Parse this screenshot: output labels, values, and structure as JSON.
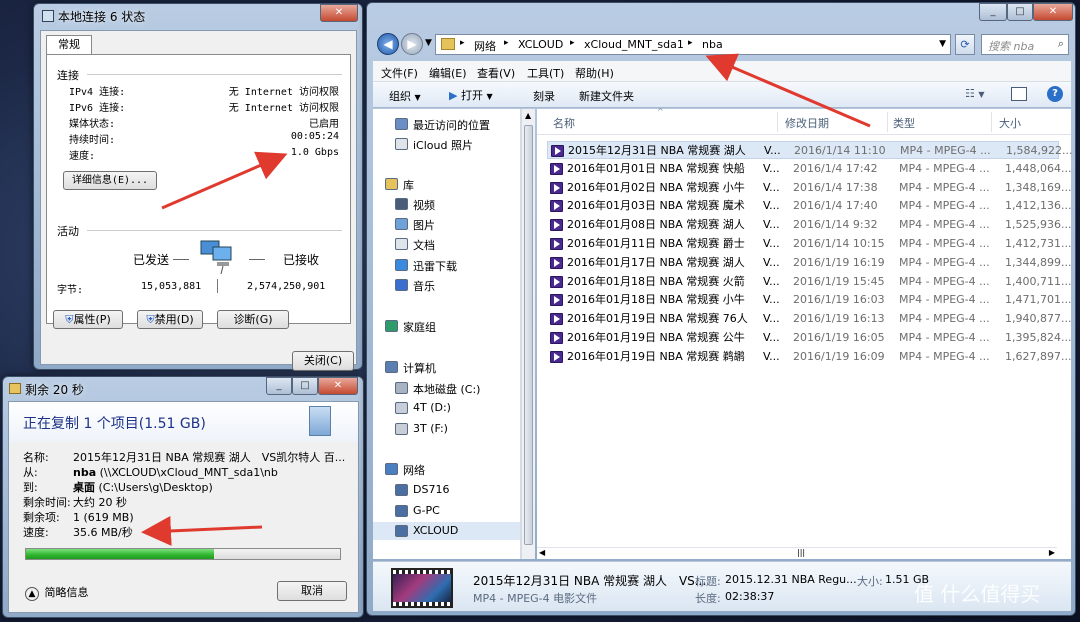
{
  "status_window": {
    "title": "本地连接 6 状态",
    "tab": "常规",
    "connection_heading": "连接",
    "rows": [
      {
        "label": "IPv4 连接:",
        "value": "无 Internet 访问权限"
      },
      {
        "label": "IPv6 连接:",
        "value": "无 Internet 访问权限"
      },
      {
        "label": "媒体状态:",
        "value": "已启用"
      },
      {
        "label": "持续时间:",
        "value": "00:05:24"
      },
      {
        "label": "速度:",
        "value": "1.0 Gbps"
      }
    ],
    "details_button": "详细信息(E)...",
    "activity_heading": "活动",
    "sent_label": "已发送",
    "received_label": "已接收",
    "bytes_label": "字节:",
    "bytes_sent": "15,053,881",
    "bytes_received": "2,574,250,901",
    "properties_button": "属性(P)",
    "disable_button": "禁用(D)",
    "diagnose_button": "诊断(G)",
    "close_button": "关闭(C)"
  },
  "copy_dialog": {
    "title": "剩余 20 秒",
    "heading": "正在复制 1 个项目(1.51 GB)",
    "rows": [
      {
        "label": "名称:",
        "value": "2015年12月31日 NBA 常规赛 湖人　VS凯尔特人 百..."
      },
      {
        "label": "从:",
        "bold": "nba",
        "value": "(\\\\XCLOUD\\xCloud_MNT_sda1\\nb"
      },
      {
        "label": "到:",
        "bold": "桌面",
        "value": "(C:\\Users\\g\\Desktop)"
      },
      {
        "label": "剩余时间:",
        "value": "大约 20 秒"
      },
      {
        "label": "剩余项:",
        "value": "1 (619 MB)"
      },
      {
        "label": "速度:",
        "value": "35.6 MB/秒"
      }
    ],
    "progress": 0.6,
    "less_info": "简略信息",
    "cancel_button": "取消"
  },
  "explorer": {
    "breadcrumb": [
      "网络",
      "XCLOUD",
      "xCloud_MNT_sda1",
      "nba"
    ],
    "search_placeholder": "搜索 nba",
    "menu": [
      "文件(F)",
      "编辑(E)",
      "查看(V)",
      "工具(T)",
      "帮助(H)"
    ],
    "toolbar": [
      "组织",
      "打开",
      "刻录",
      "新建文件夹"
    ],
    "sidebar": [
      {
        "label": "最近访问的位置",
        "icon": "recent-places-icon",
        "group": false
      },
      {
        "label": "iCloud 照片",
        "icon": "document-icon",
        "group": false
      },
      {
        "label": "库",
        "icon": "library-icon",
        "group": true
      },
      {
        "label": "视频",
        "icon": "video-icon",
        "group": false
      },
      {
        "label": "图片",
        "icon": "picture-icon",
        "group": false
      },
      {
        "label": "文档",
        "icon": "document-icon",
        "group": false
      },
      {
        "label": "迅雷下载",
        "icon": "download-icon",
        "group": false
      },
      {
        "label": "音乐",
        "icon": "music-icon",
        "group": false
      },
      {
        "label": "家庭组",
        "icon": "homegroup-icon",
        "group": true
      },
      {
        "label": "计算机",
        "icon": "computer-icon",
        "group": true
      },
      {
        "label": "本地磁盘 (C:)",
        "icon": "disk-icon",
        "group": false
      },
      {
        "label": "4T (D:)",
        "icon": "drive-icon",
        "group": false
      },
      {
        "label": "3T (F:)",
        "icon": "drive-icon",
        "group": false
      },
      {
        "label": "网络",
        "icon": "network-icon",
        "group": true
      },
      {
        "label": "DS716",
        "icon": "network-pc-icon",
        "group": false
      },
      {
        "label": "G-PC",
        "icon": "network-pc-icon",
        "group": false
      },
      {
        "label": "XCLOUD",
        "icon": "network-pc-icon",
        "group": false
      }
    ],
    "columns": [
      "名称",
      "修改日期",
      "类型",
      "大小"
    ],
    "files": [
      {
        "name": "2015年12月31日 NBA 常规赛 湖人",
        "suffix": "V...",
        "date": "2016/1/14 11:10",
        "type": "MP4 - MPEG-4 ...",
        "size": "1,584,922..."
      },
      {
        "name": "2016年01月01日 NBA 常规赛 快船",
        "suffix": "V...",
        "date": "2016/1/4 17:42",
        "type": "MP4 - MPEG-4 ...",
        "size": "1,448,064..."
      },
      {
        "name": "2016年01月02日 NBA 常规赛 小牛",
        "suffix": "V...",
        "date": "2016/1/4 17:38",
        "type": "MP4 - MPEG-4 ...",
        "size": "1,348,169..."
      },
      {
        "name": "2016年01月03日 NBA 常规赛 魔术",
        "suffix": "V...",
        "date": "2016/1/4 17:40",
        "type": "MP4 - MPEG-4 ...",
        "size": "1,412,136..."
      },
      {
        "name": "2016年01月08日 NBA 常规赛 湖人",
        "suffix": "V...",
        "date": "2016/1/14 9:32",
        "type": "MP4 - MPEG-4 ...",
        "size": "1,525,936..."
      },
      {
        "name": "2016年01月11日 NBA 常规赛 爵士",
        "suffix": "V...",
        "date": "2016/1/14 10:15",
        "type": "MP4 - MPEG-4 ...",
        "size": "1,412,731..."
      },
      {
        "name": "2016年01月17日 NBA 常规赛 湖人",
        "suffix": "V...",
        "date": "2016/1/19 16:19",
        "type": "MP4 - MPEG-4 ...",
        "size": "1,344,899..."
      },
      {
        "name": "2016年01月18日 NBA 常规赛 火箭",
        "suffix": "V...",
        "date": "2016/1/19 15:45",
        "type": "MP4 - MPEG-4 ...",
        "size": "1,400,711..."
      },
      {
        "name": "2016年01月18日 NBA 常规赛 小牛",
        "suffix": "V...",
        "date": "2016/1/19 16:03",
        "type": "MP4 - MPEG-4 ...",
        "size": "1,471,701..."
      },
      {
        "name": "2016年01月19日 NBA 常规赛 76人",
        "suffix": "V...",
        "date": "2016/1/19 16:13",
        "type": "MP4 - MPEG-4 ...",
        "size": "1,940,877..."
      },
      {
        "name": "2016年01月19日 NBA 常规赛 公牛",
        "suffix": "V...",
        "date": "2016/1/19 16:05",
        "type": "MP4 - MPEG-4 ...",
        "size": "1,395,824..."
      },
      {
        "name": "2016年01月19日 NBA 常规赛 鹈鹕",
        "suffix": "V...",
        "date": "2016/1/19 16:09",
        "type": "MP4 - MPEG-4 ...",
        "size": "1,627,897..."
      }
    ],
    "details": {
      "name": "2015年12月31日 NBA 常规赛 湖人　VS...",
      "type": "MP4 - MPEG-4 电影文件",
      "title_label": "标题:",
      "title_value": "2015.12.31 NBA Regu...",
      "size_label": "大小:",
      "size_value": "1.51 GB",
      "length_label": "长度:",
      "length_value": "02:38:37"
    }
  },
  "watermark": "值 什么值得买",
  "colors": {
    "accent": "#1e3287",
    "progress": "#2fb52f",
    "arrow": "#e03a2f",
    "selection": "#dde8f6"
  }
}
